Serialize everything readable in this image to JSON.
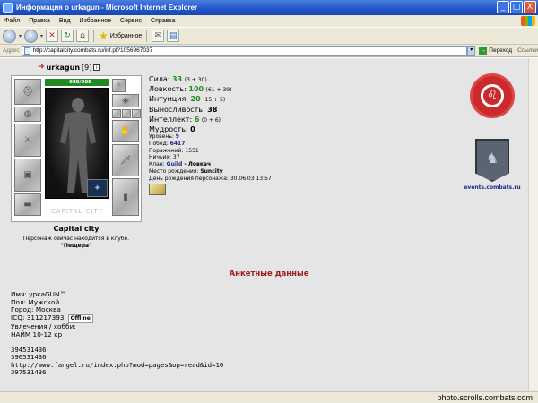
{
  "window": {
    "title": "Информация о urkagun - Microsoft Internet Explorer",
    "controls": [
      "_",
      "□",
      "X"
    ]
  },
  "menu": [
    "Файл",
    "Правка",
    "Вид",
    "Избранное",
    "Сервис",
    "Справка"
  ],
  "toolbar": {
    "favorites_label": "Избранное"
  },
  "address": {
    "label": "Адрес",
    "url": "http://capitalcity.combats.ru/inf.pl?1056967037",
    "go_label": "Переход",
    "links_label": "Ссылки"
  },
  "character": {
    "nick": "urkagun",
    "level_badge": "[9]",
    "hp": "688/688",
    "city": "Capital city",
    "location_line": "Персонаж сейчас находится в клубе.",
    "club": "\"Пещера\"",
    "city_logo_text": "CAPITAL CITY"
  },
  "stats": [
    {
      "label": "Сила:",
      "value": "33",
      "extra": "(3 + 30)",
      "green": true
    },
    {
      "label": "Ловкость:",
      "value": "100",
      "extra": "(61 + 39)",
      "green": true
    },
    {
      "label": "Интуиция:",
      "value": "20",
      "extra": "(15 + 5)",
      "green": true
    },
    {
      "label": "Выносливость:",
      "value": "38",
      "extra": "",
      "green": false
    },
    {
      "label": "Интеллект:",
      "value": "6",
      "extra": "(0 + 6)",
      "green": true
    },
    {
      "label": "Мудрость:",
      "value": "0",
      "extra": "",
      "green": false
    }
  ],
  "info": {
    "level_label": "Уровень:",
    "level": "9",
    "wins_label": "Побед:",
    "wins": "6417",
    "losses_label": "Поражений:",
    "losses": "1551",
    "draws_label": "Ничьих:",
    "draws": "37",
    "clan_label": "Клан:",
    "clan": "Guild",
    "clan_rank": " - Ловкач",
    "birthplace_label": "Место рождения:",
    "birthplace": "Suncity",
    "birthday_label": "День рождения персонажа:",
    "birthday": "30.06.03 13:57"
  },
  "events_url": "events.combats.ru",
  "section_title": "Анкетные данные",
  "profile": {
    "name": "Имя: уркаGUN™",
    "gender": "Пол: Мужской",
    "city": "Город: Москва",
    "icq": "ICQ: 311217393",
    "icq_status": "Offline",
    "hobby_label": "Увлечения / хобби:",
    "hobby": "НАЙМ 10-12 кр",
    "lines": [
      "394531436",
      "396531436",
      "http://www.fangel.ru/index.php?mod=pages&op=read&id=10",
      "397531436"
    ]
  },
  "watermark": "photo.scrolls.combats.com"
}
